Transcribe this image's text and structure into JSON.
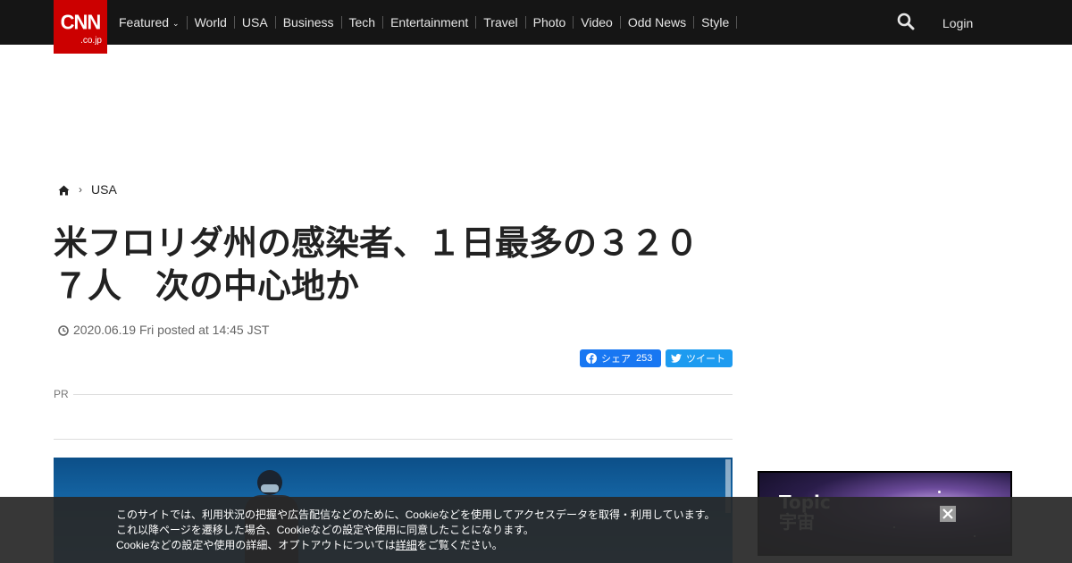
{
  "header": {
    "logo_text": "CNN",
    "logo_domain": ".co.jp",
    "nav": [
      {
        "label": "Featured",
        "has_dropdown": true
      },
      {
        "label": "World"
      },
      {
        "label": "USA"
      },
      {
        "label": "Business"
      },
      {
        "label": "Tech"
      },
      {
        "label": "Entertainment"
      },
      {
        "label": "Travel"
      },
      {
        "label": "Photo"
      },
      {
        "label": "Video"
      },
      {
        "label": "Odd News"
      },
      {
        "label": "Style"
      }
    ],
    "search_icon": "search-icon",
    "login_label": "Login"
  },
  "breadcrumb": {
    "home_icon": "home-icon",
    "section": "USA"
  },
  "article": {
    "title": "米フロリダ州の感染者、１日最多の３２０７人　次の中心地か",
    "dateline": "2020.06.19 Fri posted at 14:45 JST"
  },
  "share": {
    "facebook_label": "シェア",
    "facebook_count": "253",
    "twitter_label": "ツイート"
  },
  "pr_label": "PR",
  "side_ad": {
    "line1": "Topic",
    "line2": "宇宙"
  },
  "cookie_banner": {
    "line1": "このサイトでは、利用状況の把握や広告配信などのために、Cookieなどを使用してアクセスデータを取得・利用しています。",
    "line2": "これ以降ページを遷移した場合、Cookieなどの設定や使用に同意したことになります。",
    "line3_before": "Cookieなどの設定や使用の詳細、オプトアウトについては",
    "line3_link": "詳細",
    "line3_after": "をご覧ください。"
  },
  "colors": {
    "topbar": "#151515",
    "brand_red": "#cc0000",
    "facebook": "#1877f2",
    "twitter": "#1d9bf0"
  }
}
